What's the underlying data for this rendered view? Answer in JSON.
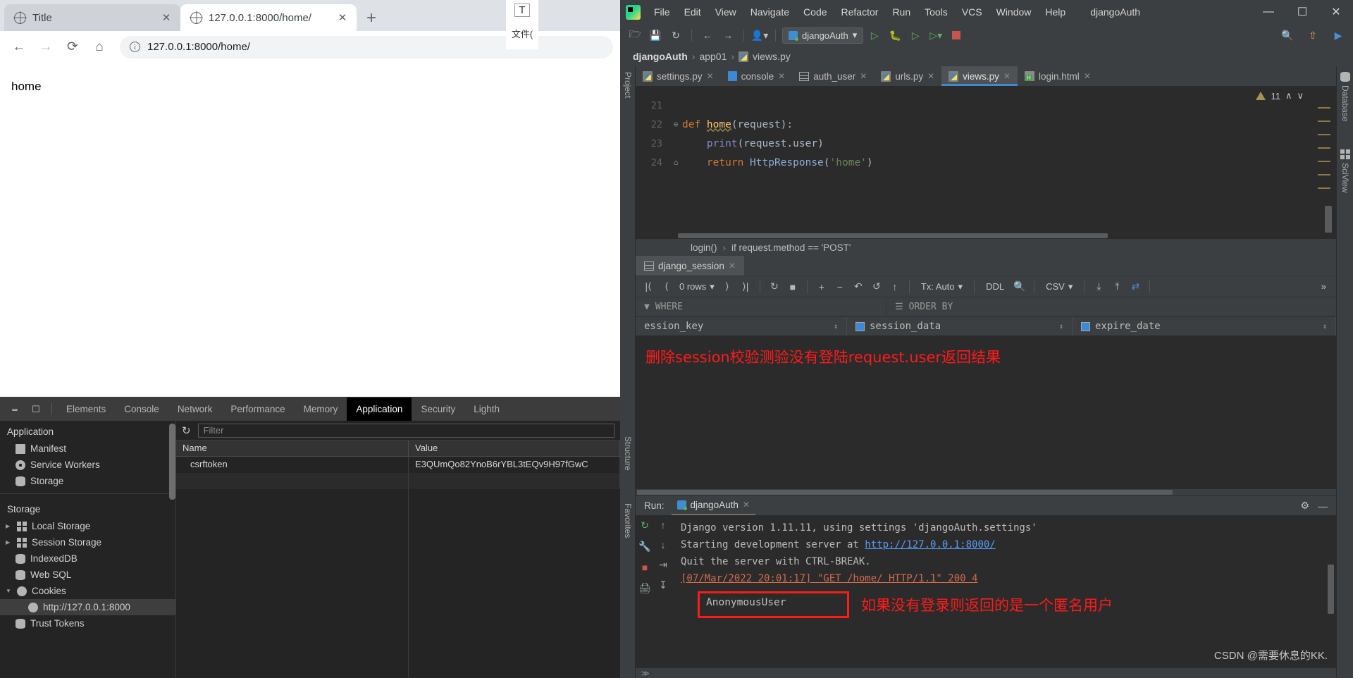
{
  "browser": {
    "tabs": [
      {
        "title": "Title",
        "active": false,
        "icon": "globe-icon"
      },
      {
        "title": "127.0.0.1:8000/home/",
        "active": true,
        "icon": "globe-icon"
      }
    ],
    "new_tab_label": "+",
    "nav": {
      "back": "←",
      "forward": "→",
      "reload": "⟳",
      "home": "⌂",
      "info_icon": "ⓘ",
      "url": "127.0.0.1:8000/home/"
    },
    "page_text": "home"
  },
  "devtools": {
    "toolbar_icons": [
      "inspect-icon",
      "device-toggle-icon"
    ],
    "tabs": [
      {
        "label": "Elements",
        "active": false
      },
      {
        "label": "Console",
        "active": false
      },
      {
        "label": "Network",
        "active": false
      },
      {
        "label": "Performance",
        "active": false
      },
      {
        "label": "Memory",
        "active": false
      },
      {
        "label": "Application",
        "active": true
      },
      {
        "label": "Security",
        "active": false
      },
      {
        "label": "Lighth",
        "active": false
      }
    ],
    "sidebar": {
      "section_application": "Application",
      "application_items": [
        {
          "label": "Manifest",
          "icon": "document-icon"
        },
        {
          "label": "Service Workers",
          "icon": "gear-icon"
        },
        {
          "label": "Storage",
          "icon": "database-icon"
        }
      ],
      "section_storage": "Storage",
      "storage_items": [
        {
          "label": "Local Storage",
          "icon": "grid-icon",
          "expandable": true,
          "selected": false,
          "indent": 1
        },
        {
          "label": "Session Storage",
          "icon": "grid-icon",
          "expandable": true,
          "selected": false,
          "indent": 1
        },
        {
          "label": "IndexedDB",
          "icon": "database-icon",
          "expandable": false,
          "selected": false,
          "indent": 1
        },
        {
          "label": "Web SQL",
          "icon": "database-icon",
          "expandable": false,
          "selected": false,
          "indent": 1
        },
        {
          "label": "Cookies",
          "icon": "cookie-icon",
          "expandable": true,
          "expanded": true,
          "selected": false,
          "indent": 1
        },
        {
          "label": "http://127.0.0.1:8000",
          "icon": "cookie-icon",
          "expandable": false,
          "selected": true,
          "indent": 2
        },
        {
          "label": "Trust Tokens",
          "icon": "database-icon",
          "expandable": false,
          "selected": false,
          "indent": 1
        }
      ]
    },
    "filter_placeholder": "Filter",
    "refresh_icon": "refresh-icon",
    "table": {
      "columns": [
        "Name",
        "Value"
      ],
      "rows": [
        {
          "name": "csrftoken",
          "value": "E3QUmQo82YnoB6rYBL3tEQv9H97fGwC"
        }
      ]
    }
  },
  "ime": {
    "t_label": "T",
    "cn_label": "文件("
  },
  "pycharm": {
    "menu": [
      "File",
      "Edit",
      "View",
      "Navigate",
      "Code",
      "Refactor",
      "Run",
      "Tools",
      "VCS",
      "Window",
      "Help"
    ],
    "project_title": "djangoAuth",
    "window_controls": {
      "minimize": "—",
      "maximize": "☐",
      "close": "✕"
    },
    "toolbar": {
      "open_icon": "folder-open-icon",
      "save_icon": "save-icon",
      "sync_icon": "sync-icon",
      "back_icon": "arrow-left-icon",
      "forward_icon": "arrow-right-icon",
      "profile_icon": "user-icon",
      "run_config": "djangoAuth",
      "run_icon": "run-icon",
      "debug_icon": "debug-icon",
      "coverage_icon": "coverage-icon",
      "profile_run_icon": "profile-run-icon",
      "stop_icon": "stop-icon",
      "search_icon": "search-icon",
      "update_icon": "update-icon",
      "browser_icon": "browser-icon"
    },
    "breadcrumb": [
      "djangoAuth",
      "app01",
      "views.py"
    ],
    "left_strip": {
      "project": "Project",
      "structure": "Structure",
      "favorites": "Favorites"
    },
    "right_strip": {
      "database": "Database",
      "sciview": "SciView"
    },
    "editor": {
      "tabs": [
        {
          "label": "settings.py",
          "icon": "python-file-icon",
          "active": false
        },
        {
          "label": "console",
          "icon": "console-icon",
          "active": false
        },
        {
          "label": "auth_user",
          "icon": "table-icon",
          "active": false
        },
        {
          "label": "urls.py",
          "icon": "python-file-icon",
          "active": false
        },
        {
          "label": "views.py",
          "icon": "python-file-icon",
          "active": true
        },
        {
          "label": "login.html",
          "icon": "html-file-icon",
          "active": false
        }
      ],
      "warning_count": "11",
      "warning_up": "∧",
      "warning_down": "∨",
      "code_lines": [
        {
          "num": "21",
          "fold": "",
          "tokens": []
        },
        {
          "num": "22",
          "fold": "⊖",
          "tokens": [
            {
              "t": "def ",
              "c": "kw"
            },
            {
              "t": "home",
              "c": "fn"
            },
            {
              "t": "(request):",
              "c": "id"
            }
          ]
        },
        {
          "num": "23",
          "fold": "",
          "tokens": [
            {
              "t": "    ",
              "c": "id"
            },
            {
              "t": "print",
              "c": "blt"
            },
            {
              "t": "(request.user)",
              "c": "id"
            }
          ]
        },
        {
          "num": "24",
          "fold": "⌂",
          "tokens": [
            {
              "t": "    ",
              "c": "id"
            },
            {
              "t": "return ",
              "c": "kw"
            },
            {
              "t": "HttpResponse",
              "c": "cls"
            },
            {
              "t": "(",
              "c": "id"
            },
            {
              "t": "'home'",
              "c": "str"
            },
            {
              "t": ")",
              "c": "id"
            }
          ]
        }
      ],
      "bottom_breadcrumb": [
        "login()",
        "if request.method == 'POST'"
      ]
    },
    "database_pane": {
      "tab_label": "django_session",
      "tab_icon": "table-icon",
      "nav": {
        "first": "|⟨",
        "prev": "⟨",
        "rows_label": "0 rows",
        "next": "⟩",
        "last": "⟩|"
      },
      "actions": {
        "refresh": "↻",
        "stop": "■",
        "add": "+",
        "remove": "−",
        "revert": "↶",
        "revert_sel": "↺",
        "submit": "↑",
        "tx": "Tx: Auto",
        "ddl": "DDL",
        "search": "search-icon",
        "csv": "CSV",
        "download": "⤓",
        "upload": "⤒",
        "compare": "compare-icon",
        "more": "»"
      },
      "filters": {
        "where": "WHERE",
        "order_by": "ORDER BY"
      },
      "columns": [
        {
          "label": "ession_key",
          "icon": "key-column-icon"
        },
        {
          "label": "session_data",
          "icon": "column-icon"
        },
        {
          "label": "expire_date",
          "icon": "column-icon"
        }
      ],
      "annotation": "删除session校验测验没有登陆request.user返回结果"
    },
    "run_pane": {
      "label": "Run:",
      "tab": "djangoAuth",
      "tab_icon": "django-icon",
      "settings_icon": "gear-icon",
      "minimize_icon": "minimize-icon",
      "gutter_icons": [
        "rerun-icon",
        "wrench-icon",
        "stop-icon",
        "scroll-icon"
      ],
      "gutter2_icons": [
        "up-arrow-icon",
        "down-arrow-icon",
        "soft-wrap-icon",
        "print-icon"
      ],
      "output": [
        {
          "text": "Django version 1.11.11, using settings 'djangoAuth.settings'",
          "style": "plain"
        },
        {
          "prefix": "Starting development server at ",
          "link": "http://127.0.0.1:8000/",
          "style": "link"
        },
        {
          "text": "Quit the server with CTRL-BREAK.",
          "style": "plain"
        },
        {
          "text": "[07/Mar/2022 20:01:17] \"GET /home/ HTTP/1.1\" 200 4",
          "style": "red"
        }
      ],
      "highlighted_output": "AnonymousUser",
      "annotation": "如果没有登录则返回的是一个匿名用户"
    },
    "watermark": "CSDN @需要休息的KK."
  },
  "colors": {
    "accent_blue": "#3d89d5",
    "annotation_red": "#ff1a1a",
    "ide_bg": "#3c3f41",
    "editor_bg": "#2b2b2b",
    "devtools_bg": "#242424"
  }
}
